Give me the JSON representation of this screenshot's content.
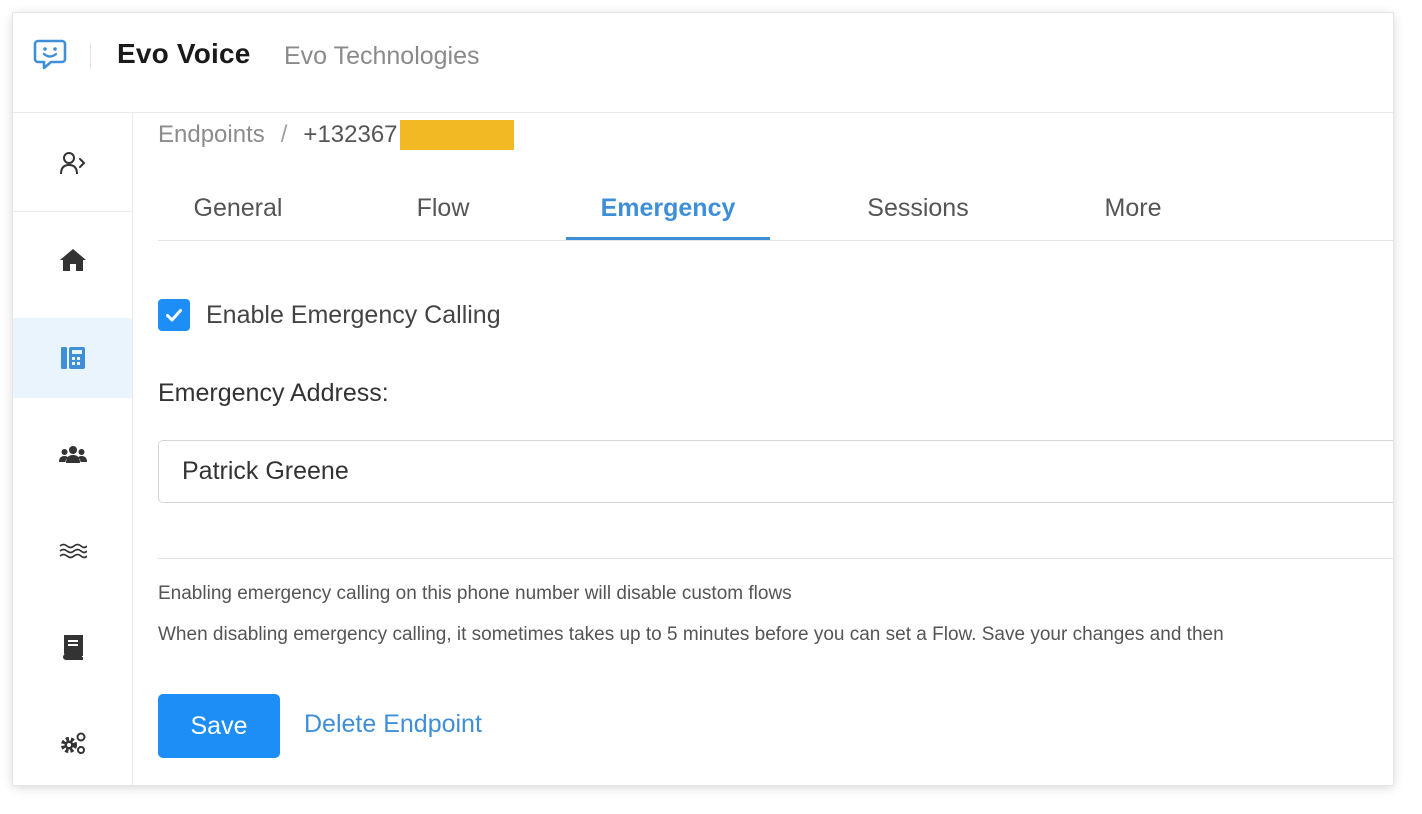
{
  "header": {
    "logo_icon": "chat-smile-icon",
    "app_title": "Evo Voice",
    "org_name": "Evo Technologies"
  },
  "sidebar": {
    "items": [
      {
        "icon": "user-switch-icon",
        "active": false
      },
      {
        "icon": "home-icon",
        "active": false
      },
      {
        "icon": "phone-book-icon",
        "active": true
      },
      {
        "icon": "users-icon",
        "active": false
      },
      {
        "icon": "waves-icon",
        "active": false
      },
      {
        "icon": "book-icon",
        "active": false
      },
      {
        "icon": "gears-icon",
        "active": false
      }
    ]
  },
  "breadcrumb": {
    "parent": "Endpoints",
    "separator": "/",
    "current": "+132367"
  },
  "tabs": [
    {
      "label": "General",
      "active": false
    },
    {
      "label": "Flow",
      "active": false
    },
    {
      "label": "Emergency",
      "active": true
    },
    {
      "label": "Sessions",
      "active": false
    },
    {
      "label": "More",
      "active": false
    }
  ],
  "emergency": {
    "enable_label": "Enable Emergency Calling",
    "enabled": true,
    "address_label": "Emergency Address:",
    "address_value": "Patrick Greene"
  },
  "notes": {
    "line1": "Enabling emergency calling on this phone number will disable custom flows",
    "line2": "When disabling emergency calling, it sometimes takes up to 5 minutes before you can set a Flow. Save your changes and then"
  },
  "actions": {
    "save_label": "Save",
    "delete_label": "Delete Endpoint"
  },
  "colors": {
    "accent": "#1e8ef7",
    "link": "#3f8fd8",
    "active_bg": "#e9f4fd",
    "redaction": "#f2b925"
  }
}
